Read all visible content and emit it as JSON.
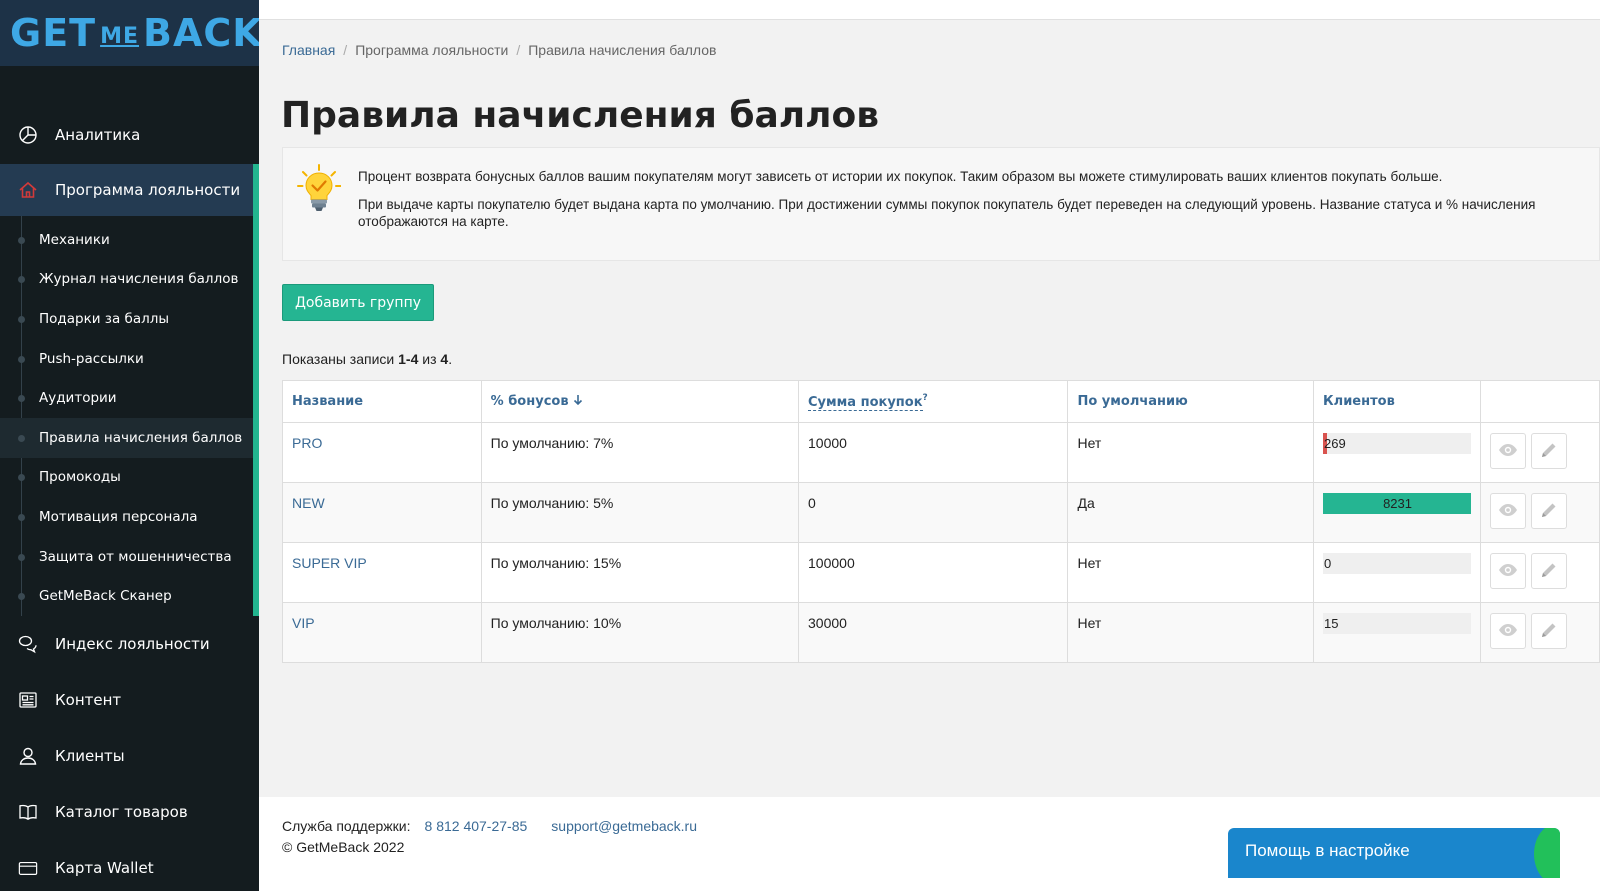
{
  "brand": {
    "logo_get": "GET",
    "logo_me": "ME",
    "logo_back": "BACK"
  },
  "sidebar": {
    "top_items": [
      {
        "label": "Аналитика",
        "icon": "pie-chart-icon"
      }
    ],
    "active_item": {
      "label": "Программа лояльности",
      "icon": "home-icon"
    },
    "sub_items": [
      "Механики",
      "Журнал начисления баллов",
      "Подарки за баллы",
      "Push-рассылки",
      "Аудитории",
      "Правила начисления баллов",
      "Промокоды",
      "Мотивация персонала",
      "Защита от мошенничества",
      "GetMeBack Сканер"
    ],
    "bottom_items": [
      {
        "label": "Индекс лояльности",
        "icon": "chat-bubbles-icon"
      },
      {
        "label": "Контент",
        "icon": "newspaper-icon"
      },
      {
        "label": "Клиенты",
        "icon": "user-icon"
      },
      {
        "label": "Каталог товаров",
        "icon": "book-icon"
      },
      {
        "label": "Карта Wallet",
        "icon": "card-icon"
      }
    ]
  },
  "breadcrumb": [
    "Главная",
    "Программа лояльности",
    "Правила начисления баллов"
  ],
  "page_title": "Правила начисления баллов",
  "info": {
    "icon": "lightbulb-icon",
    "text1": "Процент возврата бонусных баллов вашим покупателям могут зависеть от истории их покупок. Таким образом вы можете стимулировать ваших клиентов покупать больше.",
    "text2": "При выдаче карты покупателю будет выдана карта по умолчанию. При достижении суммы покупок покупатель будет переведен на следующий уровень. Название статуса и % начисления отображаются на карте."
  },
  "add_button": "Добавить группу",
  "summary": {
    "prefix": "Показаны записи ",
    "range": "1-4",
    "mid": " из ",
    "total": "4",
    "suffix": "."
  },
  "table": {
    "headers": {
      "name": "Название",
      "bonus": "% бонусов",
      "bonus_sort_icon": "arrow-down-icon",
      "sum": "Сумма покупок",
      "sum_hint": "?",
      "default": "По умолчанию",
      "clients": "Клиентов"
    },
    "rows": [
      {
        "name": "PRO",
        "bonus": "По умолчанию: 7%",
        "sum": "10000",
        "default": "Нет",
        "clients": "269",
        "share": 0.02,
        "bar_color": "#d9534f"
      },
      {
        "name": "NEW",
        "bonus": "По умолчанию: 5%",
        "sum": "0",
        "default": "Да",
        "clients": "8231",
        "share": 1.0,
        "bar_color": "#25b592"
      },
      {
        "name": "SUPER VIP",
        "bonus": "По умолчанию: 15%",
        "sum": "100000",
        "default": "Нет",
        "clients": "0",
        "share": 0,
        "bar_color": "#d9534f"
      },
      {
        "name": "VIP",
        "bonus": "По умолчанию: 10%",
        "sum": "30000",
        "default": "Нет",
        "clients": "15",
        "share": 0,
        "bar_color": "#d9534f"
      }
    ]
  },
  "footer": {
    "support_label": "Служба поддержки:",
    "phone": "8 812 407-27-85",
    "email": "support@getmeback.ru",
    "copyright": "© GetMeBack 2022"
  },
  "help_widget": "Помощь в настройке",
  "colors": {
    "accent": "#25b592",
    "link": "#3a6a95",
    "sidebar_bg": "#141c1f",
    "danger": "#d9534f",
    "help_bg": "#1a86cc"
  }
}
